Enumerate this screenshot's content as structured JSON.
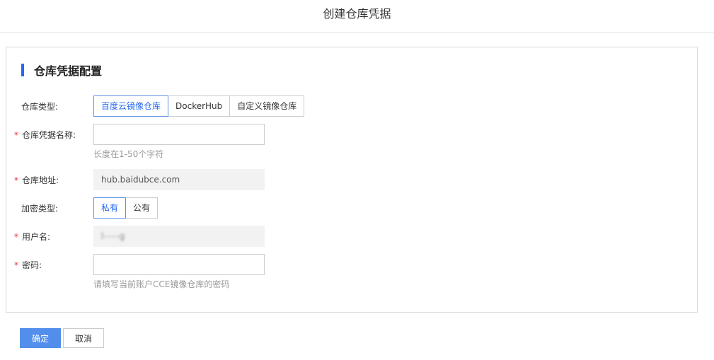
{
  "page": {
    "title": "创建仓库凭据"
  },
  "section": {
    "title": "仓库凭据配置"
  },
  "form": {
    "repo_type": {
      "label": "仓库类型:",
      "options": [
        "百度云镜像仓库",
        "DockerHub",
        "自定义镜像仓库"
      ],
      "selected": "百度云镜像仓库"
    },
    "credential_name": {
      "label": "仓库凭据名称:",
      "value": "",
      "hint": "长度在1-50个字符"
    },
    "repo_address": {
      "label": "仓库地址:",
      "value": "hub.baidubce.com"
    },
    "encryption_type": {
      "label": "加密类型:",
      "options": [
        "私有",
        "公有"
      ],
      "selected": "私有"
    },
    "username": {
      "label": "用户名:",
      "value": "l----g"
    },
    "password": {
      "label": "密码:",
      "value": "",
      "hint": "请填写当前账户CCE镜像仓库的密码"
    },
    "required_mark": "*"
  },
  "footer": {
    "ok_label": "确定",
    "cancel_label": "取消"
  },
  "colors": {
    "accent": "#2468f2",
    "primary_button": "#528eeb",
    "required": "#e8303a"
  }
}
